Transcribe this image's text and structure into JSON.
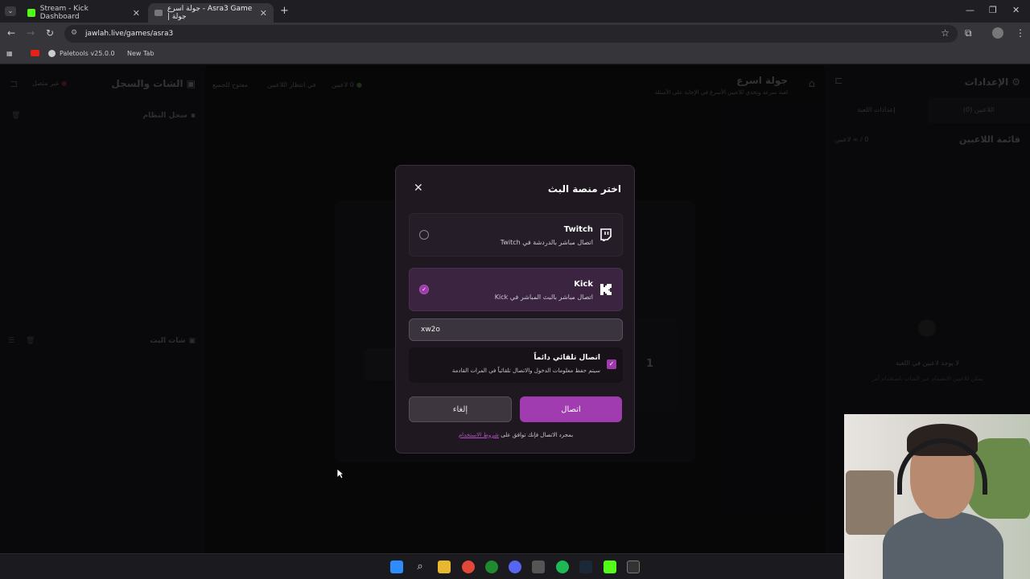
{
  "browser": {
    "tabs": [
      {
        "title": "Stream - Kick Dashboard",
        "active": false
      },
      {
        "title": "جولة اسرع - Asra3 Game | جولة",
        "active": true
      }
    ],
    "url": "jawlah.live/games/asra3",
    "bookmarks": [
      "Paletools v25.0.0",
      "New Tab"
    ]
  },
  "page": {
    "settings_title": "الإعدادات",
    "settings_tabs": [
      "اللاعبين (0)",
      "إعدادات اللعبة"
    ],
    "players_list_title": "قائمة اللاعبين",
    "players_count": "0 / ∞ لاعبين",
    "no_players": "لا يوجد لاعبين في اللعبة",
    "no_players_hint": "يمكن للاعبين الانضمام عبر الشات باستخدام أمر",
    "game_title": "جولة اسرع",
    "game_subtitle": "لعبة سرعة وتحدي للاعبين الأسرع في الإجابة على الأسئلة",
    "status_players": "0 لاعبين",
    "status_waiting": "في انتظار اللاعبين",
    "status_open": "مفتوح للجميع",
    "chat_title": "الشات والسجل",
    "chat_status": "غير متصل",
    "system_log": "سجل النظام",
    "stream_chat": "شات البث",
    "number_one": "1"
  },
  "modal": {
    "title": "اختر منصة البث",
    "options": [
      {
        "name": "Twitch",
        "desc": "اتصال مباشر بالدردشة في Twitch",
        "selected": false
      },
      {
        "name": "Kick",
        "desc": "اتصال مباشر بالبث المباشر في Kick",
        "selected": true
      }
    ],
    "username_value": "xw2o",
    "auto_title": "اتصال تلقائي دائماً",
    "auto_desc": "سيتم حفظ معلومات الدخول والاتصال تلقائياً في المرات القادمة",
    "connect_label": "اتصال",
    "cancel_label": "إلغاء",
    "terms_prefix": "بمجرد الاتصال فإنك توافق على",
    "terms_link": "شروط الاستخدام"
  },
  "colors": {
    "accent": "#a03bb0",
    "kick_green": "#53fc18",
    "twitch": "#9146ff"
  }
}
